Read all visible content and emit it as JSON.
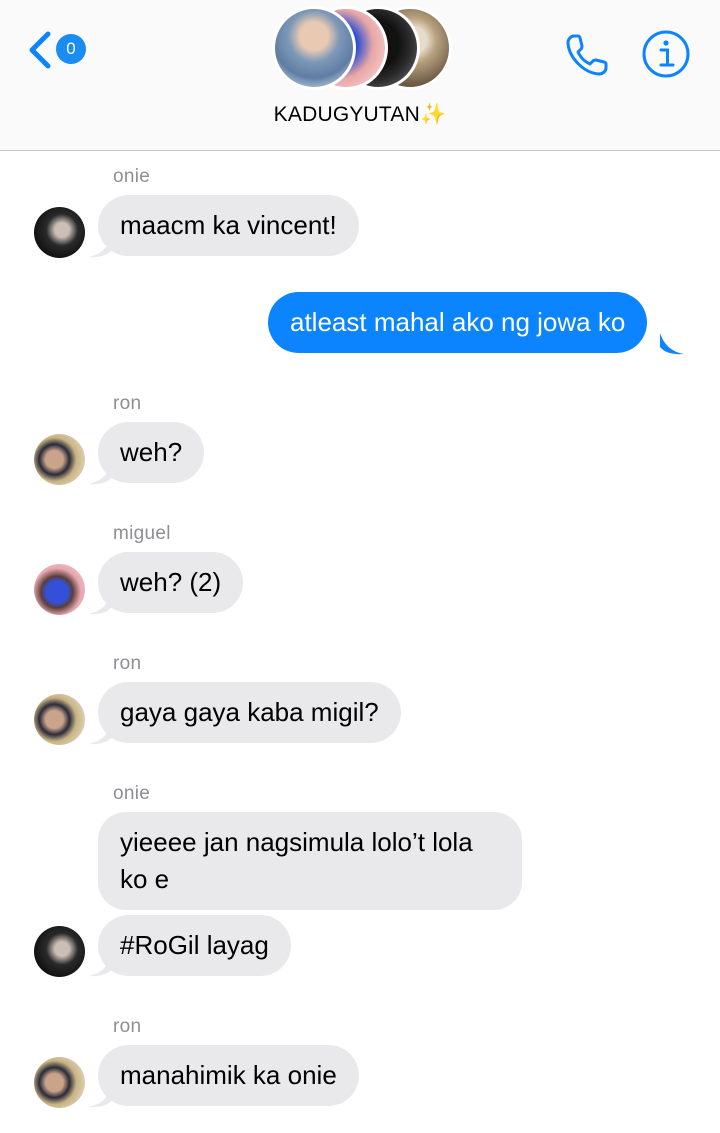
{
  "header": {
    "unread_count": "0",
    "group_title": "KADUGYUTAN✨"
  },
  "colors": {
    "accent": "#0b84fe",
    "incoming_bubble": "#e9e9eb",
    "sender_name": "#8e8e93"
  },
  "icons": {
    "back": "chevron-left-icon",
    "call": "phone-icon",
    "info": "info-icon"
  },
  "messages": [
    {
      "sender": "onie",
      "text": "maacm ka vincent!",
      "direction": "incoming"
    },
    {
      "sender": "",
      "text": "atleast mahal ako ng jowa ko",
      "direction": "outgoing"
    },
    {
      "sender": "ron",
      "text": "weh?",
      "direction": "incoming"
    },
    {
      "sender": "miguel",
      "text": "weh? (2)",
      "direction": "incoming"
    },
    {
      "sender": "ron",
      "text": "gaya gaya kaba migil?",
      "direction": "incoming"
    },
    {
      "sender": "onie",
      "text": "yieeee jan nagsimula lolo’t lola ko e",
      "direction": "incoming"
    },
    {
      "sender": "onie",
      "text": "#RoGil layag",
      "direction": "incoming"
    },
    {
      "sender": "ron",
      "text": "manahimik ka onie",
      "direction": "incoming"
    }
  ]
}
